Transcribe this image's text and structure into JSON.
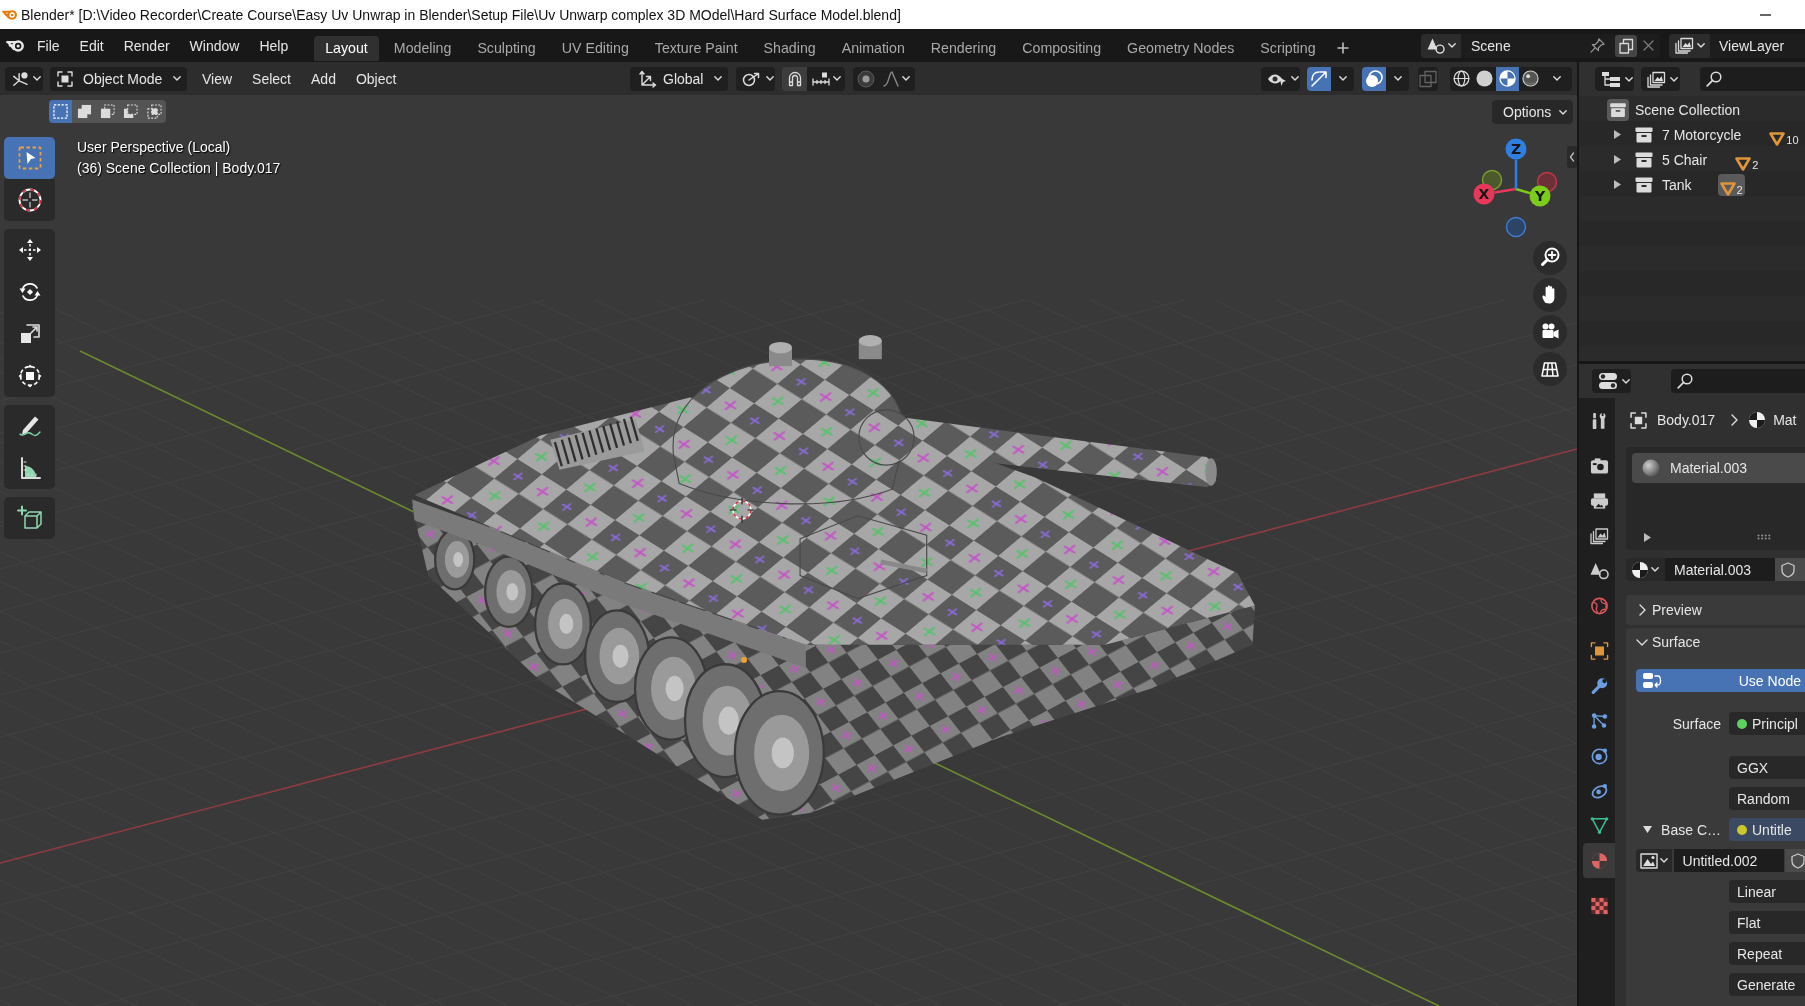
{
  "window": {
    "title": "Blender* [D:\\Video Recorder\\Create Course\\Easy Uv Unwrap in Blender\\Setup File\\Uv Unwarp complex 3D MOdel\\Hard Surface Model.blend]"
  },
  "topbar": {
    "menus": [
      "File",
      "Edit",
      "Render",
      "Window",
      "Help"
    ],
    "workspaces": [
      {
        "label": "Layout",
        "selected": true
      },
      {
        "label": "Modeling",
        "selected": false
      },
      {
        "label": "Sculpting",
        "selected": false
      },
      {
        "label": "UV Editing",
        "selected": false
      },
      {
        "label": "Texture Paint",
        "selected": false
      },
      {
        "label": "Shading",
        "selected": false
      },
      {
        "label": "Animation",
        "selected": false
      },
      {
        "label": "Rendering",
        "selected": false
      },
      {
        "label": "Compositing",
        "selected": false
      },
      {
        "label": "Geometry Nodes",
        "selected": false
      },
      {
        "label": "Scripting",
        "selected": false
      }
    ],
    "scene": "Scene",
    "view_layer": "ViewLayer"
  },
  "viewport": {
    "header": {
      "mode": "Object Mode",
      "menus": [
        "View",
        "Select",
        "Add",
        "Object"
      ],
      "orientation": "Global",
      "toggles": [
        {
          "kind": "gizmos",
          "on": true
        },
        {
          "kind": "overlays",
          "on": true
        },
        {
          "kind": "xray",
          "on": false
        }
      ],
      "shading": [
        {
          "kind": "wireframe",
          "selected": false
        },
        {
          "kind": "solid",
          "selected": false
        },
        {
          "kind": "material",
          "selected": true
        },
        {
          "kind": "rendered",
          "selected": false
        }
      ]
    },
    "select_modes": [
      {
        "kind": "new",
        "selected": true
      },
      {
        "kind": "extend",
        "selected": false
      },
      {
        "kind": "subtract",
        "selected": false
      },
      {
        "kind": "invert",
        "selected": false
      },
      {
        "kind": "intersect",
        "selected": false
      }
    ],
    "options": "Options",
    "info": [
      "User Perspective (Local)",
      "(36) Scene Collection | Body.017"
    ],
    "tools": [
      [
        {
          "kind": "select_box",
          "selected": true
        },
        {
          "kind": "cursor",
          "selected": false
        }
      ],
      [
        {
          "kind": "move",
          "selected": false
        },
        {
          "kind": "rotate",
          "selected": false
        },
        {
          "kind": "scale",
          "selected": false
        },
        {
          "kind": "transform",
          "selected": false
        }
      ],
      [
        {
          "kind": "annotate",
          "selected": false
        },
        {
          "kind": "measure",
          "selected": false
        }
      ],
      [
        {
          "kind": "add_cube",
          "selected": false
        }
      ]
    ],
    "axes": [
      {
        "kind": "x",
        "label": "X"
      },
      {
        "kind": "y",
        "label": "Y"
      },
      {
        "kind": "z",
        "label": "Z"
      }
    ]
  },
  "outliner": {
    "root": "Scene Collection",
    "collections": [
      {
        "label": "7 Motorcycle",
        "count": "10",
        "expanded": false,
        "active": false
      },
      {
        "label": "5 Chair",
        "count": "2",
        "expanded": false,
        "active": false
      },
      {
        "label": "Tank",
        "count": "2",
        "expanded": false,
        "active": true
      }
    ]
  },
  "properties": {
    "tabs": [
      [
        {
          "kind": "tool",
          "selected": false
        }
      ],
      [
        {
          "kind": "render",
          "selected": false
        },
        {
          "kind": "output",
          "selected": false
        },
        {
          "kind": "view_layer",
          "selected": false
        },
        {
          "kind": "scene",
          "selected": false
        },
        {
          "kind": "world",
          "selected": false
        }
      ],
      [
        {
          "kind": "object",
          "selected": false
        },
        {
          "kind": "modifiers",
          "selected": false
        },
        {
          "kind": "particles",
          "selected": false
        },
        {
          "kind": "physics",
          "selected": false
        },
        {
          "kind": "constraints",
          "selected": false
        },
        {
          "kind": "data",
          "selected": false
        },
        {
          "kind": "material",
          "selected": true
        }
      ],
      [
        {
          "kind": "texture",
          "selected": false
        }
      ]
    ],
    "breadcrumb": [
      "Body.017",
      "Mat"
    ],
    "slots": [
      {
        "label": "Material.003",
        "selected": true
      }
    ],
    "material": "Material.003",
    "panels": [
      {
        "label": "Preview",
        "expanded": false
      },
      {
        "label": "Surface",
        "expanded": true,
        "use_nodes": "Use Node",
        "fields": [
          {
            "kind": "socket",
            "label": "Surface",
            "value": "Principl",
            "color": "#5fcf5f"
          },
          {
            "kind": "menu",
            "value": "GGX"
          },
          {
            "kind": "menu",
            "value": "Random"
          },
          {
            "kind": "linked",
            "label": "Base C…",
            "value": "Untitle",
            "color": "#c9c92b",
            "expanded": true
          },
          {
            "kind": "image",
            "value": "Untitled.002"
          },
          {
            "kind": "menu",
            "value": "Linear"
          },
          {
            "kind": "menu",
            "value": "Flat"
          },
          {
            "kind": "menu",
            "value": "Repeat"
          },
          {
            "kind": "menu",
            "value": "Generate"
          }
        ]
      }
    ]
  }
}
